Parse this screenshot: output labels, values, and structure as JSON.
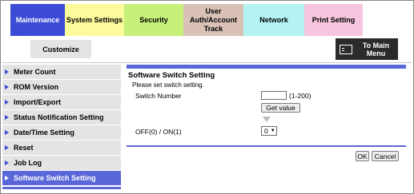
{
  "tabs": [
    {
      "label": "Maintenance",
      "bg": "#3b4bd6",
      "fg": "#ffffff",
      "width": 68
    },
    {
      "label": "System Settings",
      "bg": "#fbfb9c",
      "fg": "#000000",
      "width": 74
    },
    {
      "label": "Security",
      "bg": "#c6f07a",
      "fg": "#000000",
      "width": 74
    },
    {
      "label": "User Auth/Account Track",
      "bg": "#d9c1b6",
      "fg": "#000000",
      "width": 75
    },
    {
      "label": "Network",
      "bg": "#b3f3f3",
      "fg": "#000000",
      "width": 76
    },
    {
      "label": "Print Setting",
      "bg": "#f7c6de",
      "fg": "#000000",
      "width": 73
    }
  ],
  "subtab": {
    "label": "Customize"
  },
  "main_menu": {
    "label": "To Main Menu"
  },
  "sidebar": {
    "items": [
      {
        "label": "Meter Count"
      },
      {
        "label": "ROM Version"
      },
      {
        "label": "Import/Export"
      },
      {
        "label": "Status Notification Setting"
      },
      {
        "label": "Date/Time Setting"
      },
      {
        "label": "Reset"
      },
      {
        "label": "Job Log"
      },
      {
        "label": "Software Switch Setting",
        "active": true
      }
    ]
  },
  "content": {
    "title": "Software Switch Setting",
    "hint": "Please set switch setting.",
    "switch_label": "Switch Number",
    "switch_value": "",
    "range": "(1-200)",
    "get_value": "Get value",
    "onoff_label": "OFF(0) / ON(1)",
    "onoff_value": "0"
  },
  "buttons": {
    "ok": "OK",
    "cancel": "Cancel"
  },
  "colors": {
    "accent": "#5a67d8",
    "nav_active": "#3b4bd6"
  }
}
